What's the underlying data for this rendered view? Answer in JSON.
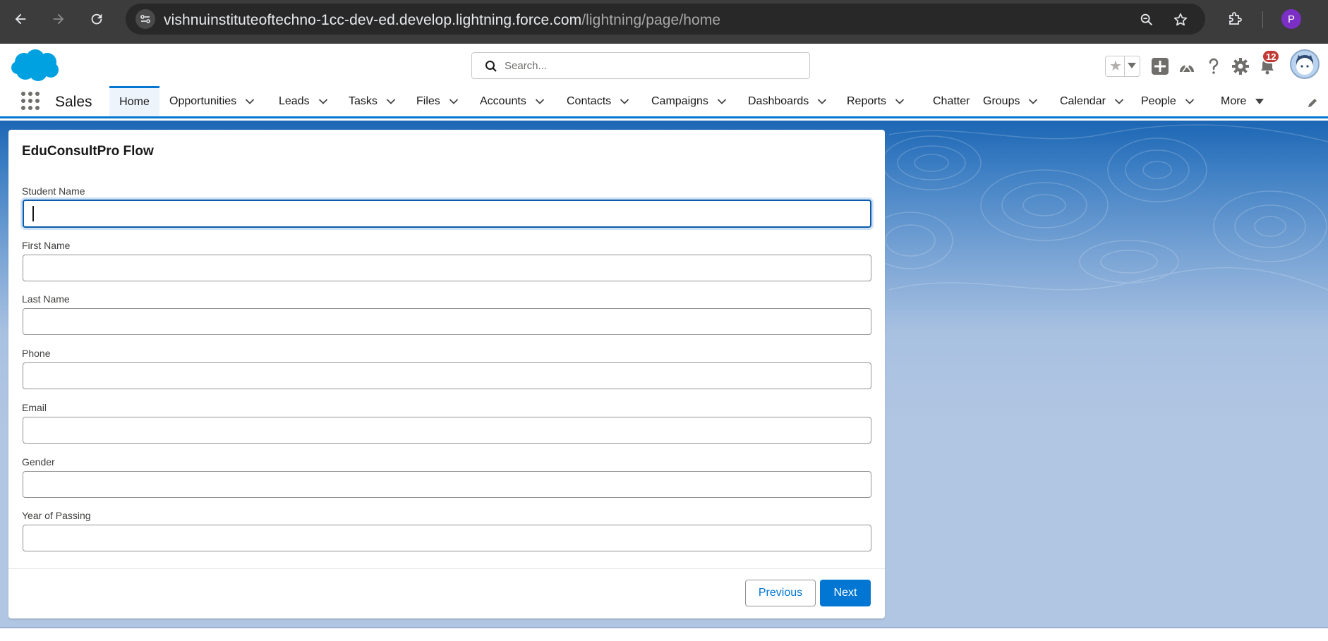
{
  "browser": {
    "url_host": "vishnuinstituteoftechno-1cc-dev-ed.develop.lightning.force.com",
    "url_path": "/lightning/page/home",
    "profile_initial": "P"
  },
  "header": {
    "search_placeholder": "Search...",
    "notification_count": "12"
  },
  "nav": {
    "app_name": "Sales",
    "items": [
      {
        "label": "Home",
        "has_menu": false,
        "active": true
      },
      {
        "label": "Opportunities",
        "has_menu": true
      },
      {
        "label": "Leads",
        "has_menu": true
      },
      {
        "label": "Tasks",
        "has_menu": true
      },
      {
        "label": "Files",
        "has_menu": true
      },
      {
        "label": "Accounts",
        "has_menu": true
      },
      {
        "label": "Contacts",
        "has_menu": true
      },
      {
        "label": "Campaigns",
        "has_menu": true
      },
      {
        "label": "Dashboards",
        "has_menu": true
      },
      {
        "label": "Reports",
        "has_menu": true
      },
      {
        "label": "Chatter",
        "has_menu": false
      },
      {
        "label": "Groups",
        "has_menu": true
      },
      {
        "label": "Calendar",
        "has_menu": true
      },
      {
        "label": "People",
        "has_menu": true
      },
      {
        "label": "More",
        "has_menu": true
      }
    ]
  },
  "flow": {
    "title": "EduConsultPro Flow",
    "fields": [
      {
        "label": "Student Name",
        "value": ""
      },
      {
        "label": "First Name",
        "value": ""
      },
      {
        "label": "Last Name",
        "value": ""
      },
      {
        "label": "Phone",
        "value": ""
      },
      {
        "label": "Email",
        "value": ""
      },
      {
        "label": "Gender",
        "value": ""
      },
      {
        "label": "Year of Passing",
        "value": ""
      }
    ],
    "previous_label": "Previous",
    "next_label": "Next"
  },
  "colors": {
    "brand": "#0176d3",
    "focus": "#0b5cab",
    "badge": "#c23934"
  }
}
